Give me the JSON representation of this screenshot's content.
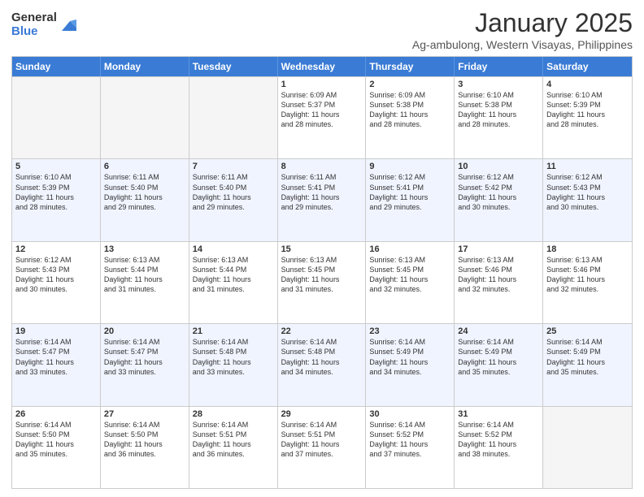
{
  "logo": {
    "general": "General",
    "blue": "Blue"
  },
  "title": "January 2025",
  "subtitle": "Ag-ambulong, Western Visayas, Philippines",
  "header_days": [
    "Sunday",
    "Monday",
    "Tuesday",
    "Wednesday",
    "Thursday",
    "Friday",
    "Saturday"
  ],
  "weeks": [
    {
      "alt": false,
      "days": [
        {
          "num": "",
          "info": ""
        },
        {
          "num": "",
          "info": ""
        },
        {
          "num": "",
          "info": ""
        },
        {
          "num": "1",
          "info": "Sunrise: 6:09 AM\nSunset: 5:37 PM\nDaylight: 11 hours\nand 28 minutes."
        },
        {
          "num": "2",
          "info": "Sunrise: 6:09 AM\nSunset: 5:38 PM\nDaylight: 11 hours\nand 28 minutes."
        },
        {
          "num": "3",
          "info": "Sunrise: 6:10 AM\nSunset: 5:38 PM\nDaylight: 11 hours\nand 28 minutes."
        },
        {
          "num": "4",
          "info": "Sunrise: 6:10 AM\nSunset: 5:39 PM\nDaylight: 11 hours\nand 28 minutes."
        }
      ]
    },
    {
      "alt": true,
      "days": [
        {
          "num": "5",
          "info": "Sunrise: 6:10 AM\nSunset: 5:39 PM\nDaylight: 11 hours\nand 28 minutes."
        },
        {
          "num": "6",
          "info": "Sunrise: 6:11 AM\nSunset: 5:40 PM\nDaylight: 11 hours\nand 29 minutes."
        },
        {
          "num": "7",
          "info": "Sunrise: 6:11 AM\nSunset: 5:40 PM\nDaylight: 11 hours\nand 29 minutes."
        },
        {
          "num": "8",
          "info": "Sunrise: 6:11 AM\nSunset: 5:41 PM\nDaylight: 11 hours\nand 29 minutes."
        },
        {
          "num": "9",
          "info": "Sunrise: 6:12 AM\nSunset: 5:41 PM\nDaylight: 11 hours\nand 29 minutes."
        },
        {
          "num": "10",
          "info": "Sunrise: 6:12 AM\nSunset: 5:42 PM\nDaylight: 11 hours\nand 30 minutes."
        },
        {
          "num": "11",
          "info": "Sunrise: 6:12 AM\nSunset: 5:43 PM\nDaylight: 11 hours\nand 30 minutes."
        }
      ]
    },
    {
      "alt": false,
      "days": [
        {
          "num": "12",
          "info": "Sunrise: 6:12 AM\nSunset: 5:43 PM\nDaylight: 11 hours\nand 30 minutes."
        },
        {
          "num": "13",
          "info": "Sunrise: 6:13 AM\nSunset: 5:44 PM\nDaylight: 11 hours\nand 31 minutes."
        },
        {
          "num": "14",
          "info": "Sunrise: 6:13 AM\nSunset: 5:44 PM\nDaylight: 11 hours\nand 31 minutes."
        },
        {
          "num": "15",
          "info": "Sunrise: 6:13 AM\nSunset: 5:45 PM\nDaylight: 11 hours\nand 31 minutes."
        },
        {
          "num": "16",
          "info": "Sunrise: 6:13 AM\nSunset: 5:45 PM\nDaylight: 11 hours\nand 32 minutes."
        },
        {
          "num": "17",
          "info": "Sunrise: 6:13 AM\nSunset: 5:46 PM\nDaylight: 11 hours\nand 32 minutes."
        },
        {
          "num": "18",
          "info": "Sunrise: 6:13 AM\nSunset: 5:46 PM\nDaylight: 11 hours\nand 32 minutes."
        }
      ]
    },
    {
      "alt": true,
      "days": [
        {
          "num": "19",
          "info": "Sunrise: 6:14 AM\nSunset: 5:47 PM\nDaylight: 11 hours\nand 33 minutes."
        },
        {
          "num": "20",
          "info": "Sunrise: 6:14 AM\nSunset: 5:47 PM\nDaylight: 11 hours\nand 33 minutes."
        },
        {
          "num": "21",
          "info": "Sunrise: 6:14 AM\nSunset: 5:48 PM\nDaylight: 11 hours\nand 33 minutes."
        },
        {
          "num": "22",
          "info": "Sunrise: 6:14 AM\nSunset: 5:48 PM\nDaylight: 11 hours\nand 34 minutes."
        },
        {
          "num": "23",
          "info": "Sunrise: 6:14 AM\nSunset: 5:49 PM\nDaylight: 11 hours\nand 34 minutes."
        },
        {
          "num": "24",
          "info": "Sunrise: 6:14 AM\nSunset: 5:49 PM\nDaylight: 11 hours\nand 35 minutes."
        },
        {
          "num": "25",
          "info": "Sunrise: 6:14 AM\nSunset: 5:49 PM\nDaylight: 11 hours\nand 35 minutes."
        }
      ]
    },
    {
      "alt": false,
      "days": [
        {
          "num": "26",
          "info": "Sunrise: 6:14 AM\nSunset: 5:50 PM\nDaylight: 11 hours\nand 35 minutes."
        },
        {
          "num": "27",
          "info": "Sunrise: 6:14 AM\nSunset: 5:50 PM\nDaylight: 11 hours\nand 36 minutes."
        },
        {
          "num": "28",
          "info": "Sunrise: 6:14 AM\nSunset: 5:51 PM\nDaylight: 11 hours\nand 36 minutes."
        },
        {
          "num": "29",
          "info": "Sunrise: 6:14 AM\nSunset: 5:51 PM\nDaylight: 11 hours\nand 37 minutes."
        },
        {
          "num": "30",
          "info": "Sunrise: 6:14 AM\nSunset: 5:52 PM\nDaylight: 11 hours\nand 37 minutes."
        },
        {
          "num": "31",
          "info": "Sunrise: 6:14 AM\nSunset: 5:52 PM\nDaylight: 11 hours\nand 38 minutes."
        },
        {
          "num": "",
          "info": ""
        }
      ]
    }
  ]
}
